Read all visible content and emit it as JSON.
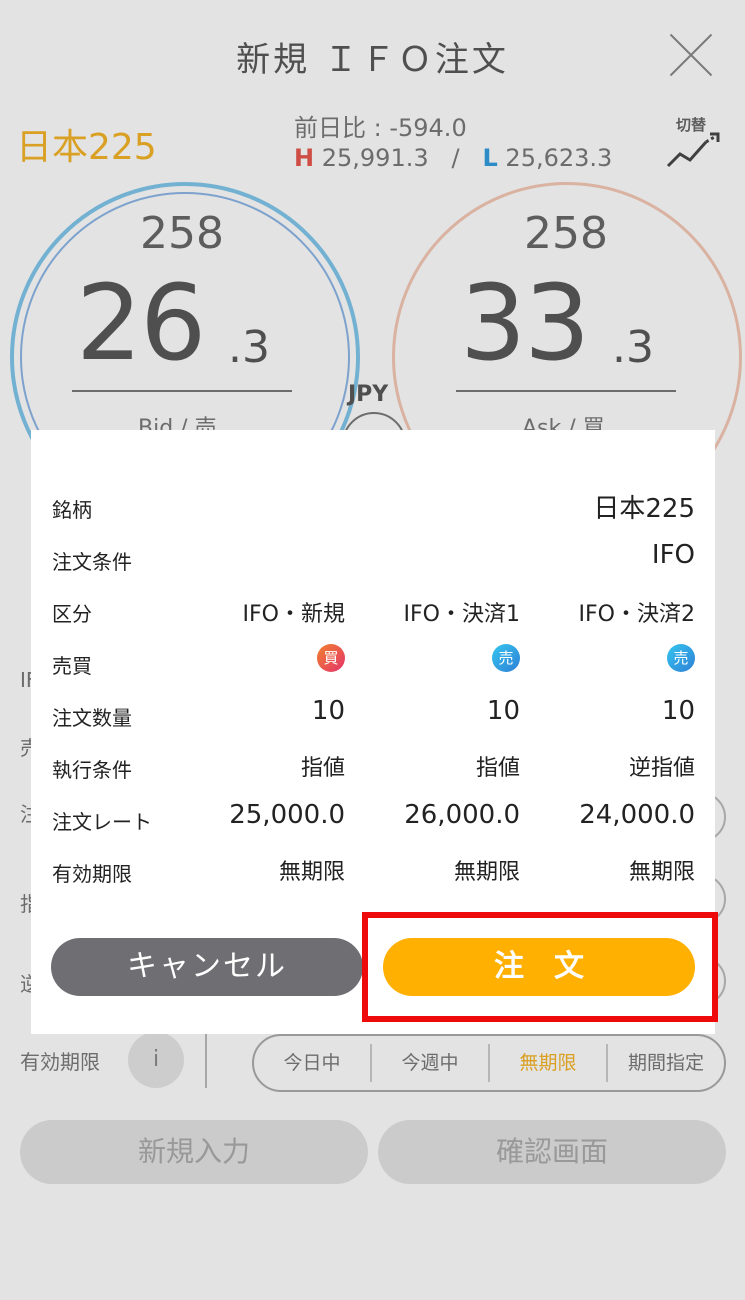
{
  "header": {
    "title": "新規 ＩＦＯ注文"
  },
  "ticker": {
    "symbol": "日本225",
    "change_text": "前日比 : -594.0",
    "high_label": "H",
    "high_value": "25,991.3",
    "separator": "/",
    "low_label": "L",
    "low_value": "25,623.3",
    "switch_label": "切替"
  },
  "bid": {
    "top": "258",
    "big": "26",
    "small": ".3",
    "label": "Bid / 売"
  },
  "ask": {
    "top": "258",
    "big": "33",
    "small": ".3",
    "label": "Ask / 買"
  },
  "currency": "JPY",
  "form": {
    "expiry_label": "有効期限",
    "info_icon": "i",
    "expiry_options": [
      "今日中",
      "今週中",
      "無期限",
      "期間指定"
    ],
    "new_entry_button": "新規入力",
    "confirm_button": "確認画面",
    "partial_labels": [
      "IF",
      "売",
      "注",
      "指",
      "逆"
    ]
  },
  "modal": {
    "rows": {
      "symbol": {
        "label": "銘柄",
        "value": "日本225"
      },
      "condition": {
        "label": "注文条件",
        "value": "IFO"
      },
      "category": {
        "label": "区分",
        "values": [
          "IFO・新規",
          "IFO・決済1",
          "IFO・決済2"
        ]
      },
      "side": {
        "label": "売買",
        "values": [
          "買",
          "売",
          "売"
        ]
      },
      "quantity": {
        "label": "注文数量",
        "values": [
          "10",
          "10",
          "10"
        ]
      },
      "execution": {
        "label": "執行条件",
        "values": [
          "指値",
          "指値",
          "逆指値"
        ]
      },
      "rate": {
        "label": "注文レート",
        "values": [
          "25,000.0",
          "26,000.0",
          "24,000.0"
        ]
      },
      "expiry": {
        "label": "有効期限",
        "values": [
          "無期限",
          "無期限",
          "無期限"
        ]
      }
    },
    "cancel_button": "キャンセル",
    "order_button": "注　文"
  },
  "colors": {
    "accent_orange": "#ffb000",
    "cancel_gray": "#6e6e73",
    "highlight_red": "#ee0a0a",
    "buy_badge": "#e5336c",
    "sell_badge": "#2e7fd6"
  }
}
